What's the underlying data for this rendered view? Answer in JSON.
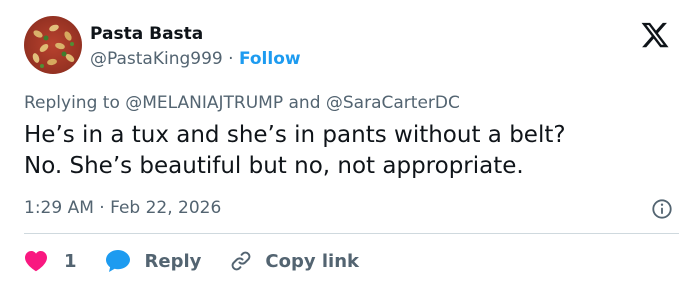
{
  "author": {
    "display_name": "Pasta Basta",
    "handle": "@PastaKing999",
    "separator": "·",
    "follow_label": "Follow"
  },
  "reply_context": {
    "prefix": "Replying to",
    "mention_1": "@MELANIAJTRUMP",
    "joiner": "and",
    "mention_2": "@SaraCarterDC"
  },
  "tweet": {
    "text": "He’s in a tux and she’s in pants without a belt?\nNo.  She’s beautiful but no, not appropriate."
  },
  "meta": {
    "time": "1:29 AM",
    "separator": "·",
    "date": "Feb 22, 2026"
  },
  "actions": {
    "like_count": "1",
    "reply_label": "Reply",
    "copy_link_label": "Copy link"
  },
  "icons": {
    "platform": "x-logo-icon",
    "info": "info-icon",
    "like": "heart-icon",
    "reply": "speech-bubble-icon",
    "copy": "link-icon"
  },
  "colors": {
    "text_primary": "#0f1419",
    "text_secondary": "#536471",
    "accent": "#1d9bf0",
    "like": "#f91880",
    "divider": "#cfd9de"
  }
}
